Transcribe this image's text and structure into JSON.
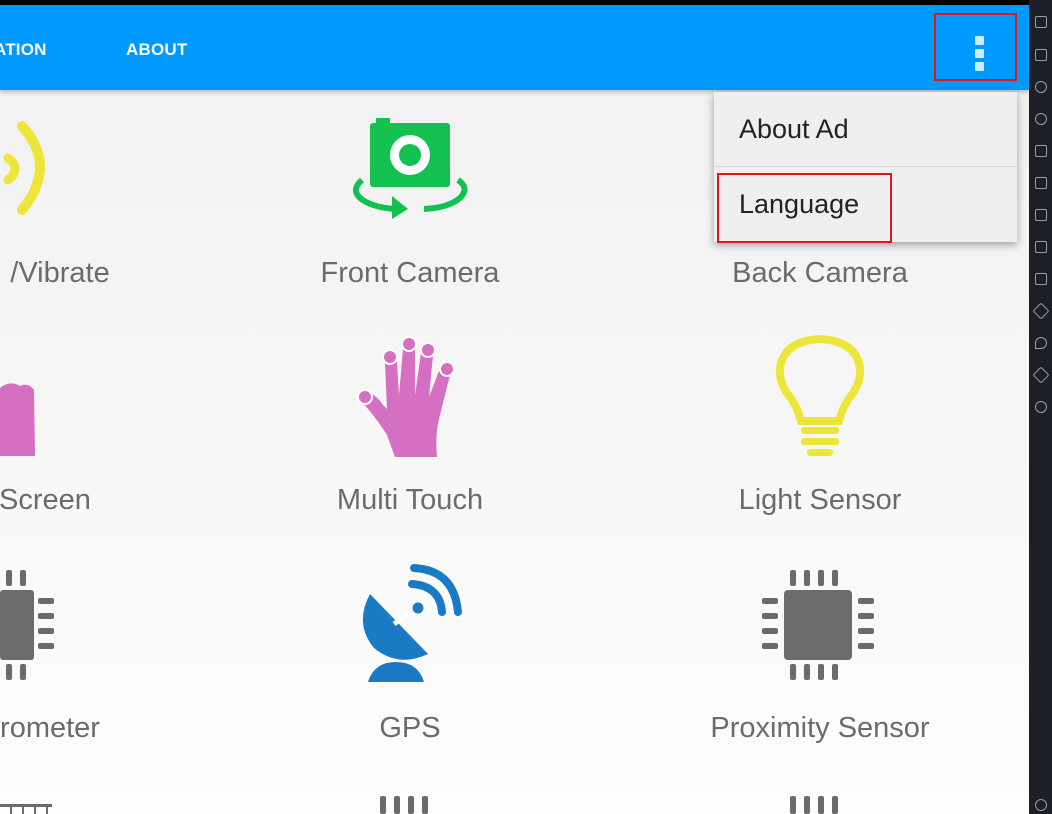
{
  "appbar": {
    "tabs": [
      {
        "label": "ATION"
      },
      {
        "label": "ABOUT"
      }
    ],
    "overflow_icon": "more-vert-icon",
    "color": "#0099ff"
  },
  "menu": {
    "items": [
      {
        "label": "About Ad"
      },
      {
        "label": "Language"
      }
    ]
  },
  "grid": {
    "items": [
      {
        "label": "/Vibrate",
        "icon": "vibrate-icon"
      },
      {
        "label": "Front Camera",
        "icon": "front-camera-icon"
      },
      {
        "label": "Back Camera",
        "icon": "back-camera-icon"
      },
      {
        "label": "Screen",
        "icon": "touch-screen-icon"
      },
      {
        "label": "Multi Touch",
        "icon": "multi-touch-hand-icon"
      },
      {
        "label": "Light Sensor",
        "icon": "light-bulb-icon"
      },
      {
        "label": "rometer",
        "icon": "chip-icon"
      },
      {
        "label": "GPS",
        "icon": "satellite-dish-icon"
      },
      {
        "label": "Proximity Sensor",
        "icon": "chip-icon"
      }
    ]
  },
  "colors": {
    "highlight": "#e3161b",
    "camera_green": "#14c150",
    "touch_pink": "#d56fc1",
    "sensor_yellow": "#ede63a",
    "gps_blue": "#1a7ac4",
    "chip_gray": "#6b6b6b"
  },
  "sidebar": {
    "icons": [
      "cursor-icon",
      "keyboard-icon",
      "play-icon",
      "record-icon",
      "robot-icon",
      "apk-icon",
      "screenshot-icon",
      "folder-icon",
      "device-icon",
      "erase-icon",
      "location-icon",
      "layers-icon",
      "speed-icon",
      "settings-icon"
    ]
  }
}
